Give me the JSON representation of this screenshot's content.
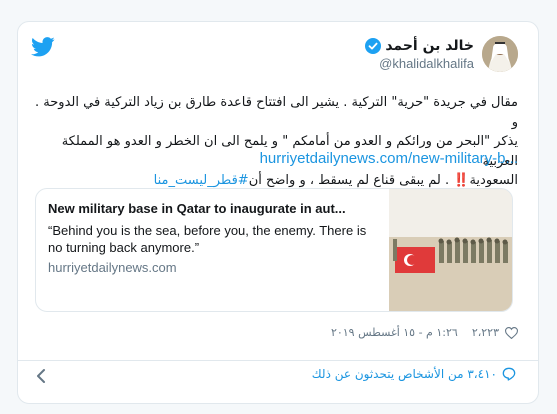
{
  "author": {
    "display_name": "خالد بن أحمد",
    "handle": "@khalidalkhalifa"
  },
  "tweet": {
    "text_line1": "مقال في جريدة \"حرية\" التركية . يشير الى افتتاح قاعدة طارق بن زياد التركية في الدوحة . و",
    "text_line2": "يذكر \"البحر من ورائكم و العدو من أمامكم \" و يلمح الى ان الخطر و العدو هو المملكة العربية",
    "text_line3_plain": "السعودية‼️ . لم يبقى قناع لم يسقط ، و  واضح أن",
    "hashtag": "#قطر_ليست_منا",
    "url": "hurriyetdailynews.com/new-military-b..."
  },
  "link_card": {
    "title": "New military base in Qatar to inaugurate in aut...",
    "description": "“Behind you is the sea, before you, the enemy. There is no turning back anymore.”",
    "domain": "hurriyetdailynews.com"
  },
  "meta": {
    "likes": "٢،٢٢٣",
    "timestamp": "١:٢٦ م - ١٥ أغسطس ٢٠١٩"
  },
  "footer": {
    "people_talking": "٣،٤١٠ من الأشخاص يتحدثون عن ذلك"
  },
  "colors": {
    "link": "#1b95e0",
    "twitter_blue": "#1da1f2",
    "verified": "#1da1f2",
    "muted": "#657786",
    "border": "#e1e8ed"
  },
  "icons": [
    "twitter-bird-icon",
    "verified-badge-icon",
    "heart-icon",
    "chat-bubble-icon",
    "chevron-left-icon"
  ]
}
